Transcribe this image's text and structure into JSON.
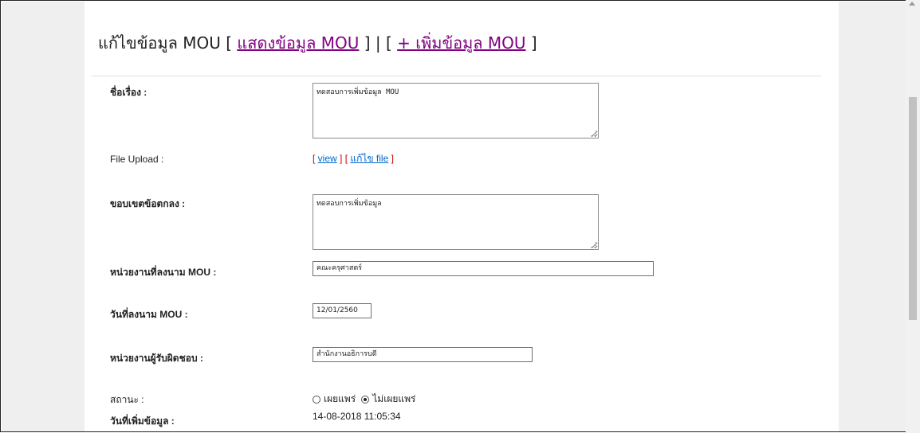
{
  "header": {
    "title_prefix": "แก้ไขข้อมูล MOU [ ",
    "show_link": "แสดงข้อมูล MOU",
    "title_middle": " ] | [ ",
    "add_link": "+ เพิ่มข้อมูล MOU",
    "title_suffix": " ]"
  },
  "form": {
    "subject": {
      "label": "ชื่อเรื่อง :",
      "value": "ทดสอบการเพิ่มข้อมูล MOU"
    },
    "file_upload": {
      "label": "File Upload :",
      "open_bracket": "[ ",
      "view_link": "view",
      "middle": " ] [ ",
      "edit_link": "แก้ไข file",
      "close_bracket": " ]"
    },
    "scope": {
      "label": "ขอบเขตข้อตกลง :",
      "value": "ทดสอบการเพิ่มข้อมูล"
    },
    "signing_unit": {
      "label": "หน่วยงานที่ลงนาม MOU :",
      "value": "คณะครุศาสตร์"
    },
    "signing_date": {
      "label": "วันที่ลงนาม MOU :",
      "value": "12/01/2560"
    },
    "responsible_unit": {
      "label": "หน่วยงานผู้รับผิดชอบ :",
      "value": "สำนักงานอธิการบดี"
    },
    "status": {
      "label": "สถานะ :",
      "options": [
        "เผยแพร่",
        "ไม่เผยแพร่"
      ],
      "selected": "ไม่เผยแพร่"
    },
    "added_date": {
      "label": "วันที่เพิ่มข้อมูล :",
      "value": "14-08-2018 11:05:34"
    }
  },
  "colors": {
    "title_link": "#800080",
    "file_link": "#0066cc",
    "bracket": "#cc0000",
    "side_background": "#efefef"
  }
}
